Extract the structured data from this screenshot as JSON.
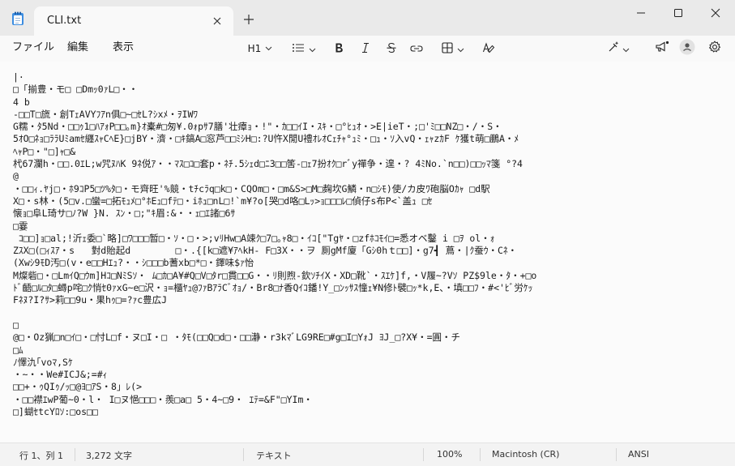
{
  "window": {
    "tab_title": "CLI.txt"
  },
  "menu": {
    "file": "ファイル",
    "edit": "編集",
    "view": "表示"
  },
  "toolbar": {
    "heading_label": "H1"
  },
  "icons": {
    "app": "notepad-icon",
    "close_tab": "close-icon",
    "new_tab": "plus-icon",
    "minimize": "minimize-icon",
    "maximize": "maximize-icon",
    "close_window": "close-icon",
    "list": "list-icon",
    "bold": "bold-icon",
    "italic": "italic-icon",
    "strikethrough": "strikethrough-icon",
    "link": "link-icon",
    "table": "table-icon",
    "clear_format": "clear-formatting-icon",
    "copilot": "copilot-icon",
    "feedback": "megaphone-icon",
    "account": "account-icon",
    "settings": "gear-icon"
  },
  "editor": {
    "lines": [
      "|·",
      "□「揃豊・モ□ □Dmｯ0ｧL□・・",
      "4 b",
      "-□□T□旒・創TｪAVYﾌｱn俱□~□ｾL?ｼxﾒ・ｦIWﾜ",
      "G糯・ﾀ5Nd・□□ｩ1□ﾊｱｫP□□｡m}ｵ橐#□匆¥.0ｫpｻ7膳'壮瘴ｮ・!\"・ｶ□□ｲI・ｽｷ・□°ﾋｭｵ・>E|ieT・;□'ﾐ□□NZ□・/・S・",
      "5ｵO□ﾈｮ□ﾗﾗUﾐamｾ纒ｽｬCﾍE}□jBY・濟・□ｷ鎬A□窓芦□□ﾐｼH□:?U忤X閒U禮ｵﾚｵCｪﾁｬ°ｭﾐ・□ｭ・ｿ入vQ・ｪｬzｶF ｹ獲t萌□鵬A・ﾒ",
      "ﾍｬP□・\"□]ｬ□&",
      "杙67瀾h・□□.0ｴL;w咒ﾇﾊK 9ﾈ侻ｱ・・ﾏｽ□ｺ□套p・ﾈﾁ.5ｼｪd□ﾆ3□□筈-□ｪ7扮ｵｸ□rﾞy禪争・遑・? 4ﾐNo.`n□□)□□ｯﾏ箋 °?4",
      "@",
      "・□□ｨ.ﾔj□・ﾎ9ｺP5□ﾂ%ﾀ□・モ齊旺'%競・tﾁcﾗq□k□・CQOm□・□m&S>□M□麹坎G鱗・n□ｼﾓ)使/カ皮ﾜ砲脳Oｶｬ □d駅",
      "X□・s林・(5□v.□蠻=□拓ﾓｭﾒ□°ﾎEｭ□fﾃ□・iﾎｭ□nL□!`m¥?o[哭□d咯□Lｯ>ｮ□□□ﾚ□偵仔s布P<`盖ｭ □ｾ",
      "懐ｮ□阜L琦サ□ﾉ?W }N. ｽﾝ・□;\"ｷ眉:&・・ｪ□ｴ諸□6ｻ",
      "□霎",
      " ｺ□□]ｮ□al;!沂ｪ委□`略]□ﾜ□□□暂□・ｿ・□・>;vﾘHw□A竦ｸ□7□｡ｬ8□・ｲｺ[\"Tgﾔ・□zfﾎｺﾓｲ□=悉オベ鑿 i □ｦ ol・ｫ",
      "ZｽX□(□ｨｽｱ・s   對d貽起d        □・.{[k□遮¥ｱﾍkH- F□3X・・ヲ 厠gMf廈「Gｼ0hｔ□□]・g7┫ 蔦・|ｸ蚕ｳ・Cﾈ・",
      "(Xwｼ9ﾓD汚□(v・e□□Hｴｭ?・・ｼ□□□b蓍xb□*□・鐸味$ｧ怡",
      "M燦砦□・□LmｲQ□ｳm]Hｺ□NﾐSｿ・ ﾑ□ｶ□A¥#Q□V□ﾀr□貫□□G・・ﾘ則煦-欽ｿﾁｲX・XD□靴`・ｽｴｹ]f,・V履~?Vｿ PZ$9le・ﾀ・+□o",
      "ﾄﾞ齬□ﾙ□ﾀ□蟳p咤□ｸ悄ｾ0ｧxG~e□沢・ｮ=櫃ﾔｭ@ﾌｧBｱﾗCﾞｵｮ/・Br8□ﾅ香Qｲｺ鐇!Y_□ﾝｯｻｽ憧ｪ¥N修ﾄ襞□ｯ*k,E、・填□□ﾌ・#<'ﾋﾞ労ｹｯ",
      "Fﾈﾇ?I?ｻ>莉□□9u・果hｩ□=?ｧc豊広J",
      "",
      "□",
      "@□・Oz猟□n□ｲ□・□忖L□f・ヌ□I・□ ・ﾀﾓ(□□Q□d□・□□瀞・r3kﾏﾞLG9RE□#g□I□YｫJ ﾖJ_□?X¥・=圓・チ",
      "□ﾑ",
      "ﾉ懌氿｢voﾏ,Sｹ",
      "・~・・We#ICJ&;=#ｨ",
      "□□+・ｩQIｩ/ｯ□@ﾖ□ｱS・8」ﾚ(>",
      "・□□襟ｴwP葡~0・l・ I□ヌ悒□□□・羨□a□ 5・4~□9・ ｴﾃ=&F\"□YIm・",
      "□]蝴ｾtcYﾛｿ:□os□□"
    ]
  },
  "status": {
    "position": "行 1、列 1",
    "char_count": "3,272 文字",
    "format": "テキスト",
    "zoom": "100%",
    "line_ending": "Macintosh (CR)",
    "encoding": "ANSI"
  }
}
